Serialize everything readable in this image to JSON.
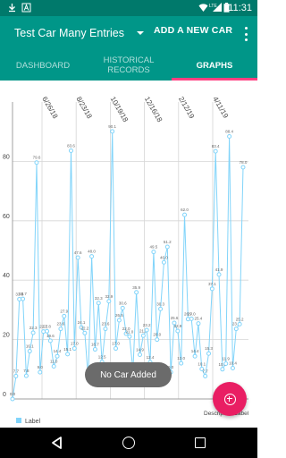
{
  "status_bar": {
    "time": "11:31",
    "left_icons": [
      "download-icon",
      "a-letter-icon"
    ],
    "right_icons": [
      "wifi-icon",
      "signal-lte-icon",
      "battery-icon"
    ],
    "lte_label": "LTE"
  },
  "app_bar": {
    "selected_car": "Test Car Many Entries",
    "add_car_label": "ADD A NEW CAR",
    "overflow_icon": "more-vert-icon"
  },
  "tabs": [
    {
      "label": "DASHBOARD",
      "active": false
    },
    {
      "label": "HISTORICAL\nRECORDS",
      "active": false
    },
    {
      "label": "GRAPHS",
      "active": true
    }
  ],
  "colors": {
    "status_bar": "#00796b",
    "primary": "#009688",
    "accent": "#ff4081",
    "fab": "#e91e63",
    "line": "#81d4fa",
    "value_text": "#666666"
  },
  "chart_data": {
    "type": "line",
    "x_tick_labels": [
      "6/26/18",
      "8/23/18",
      "10/19/18",
      "12/16/18",
      "2/12/19",
      "4/11/19"
    ],
    "y_tick_labels": [
      "0",
      "20",
      "40",
      "60",
      "80"
    ],
    "ylim": [
      0,
      100
    ],
    "legend": [
      "Label"
    ],
    "legend_position": "bottom-left",
    "description_label": "Description Label",
    "series": [
      {
        "name": "Label",
        "values": [
          0.0,
          7.7,
          33.6,
          33.7,
          7.8,
          16.1,
          22.3,
          79.6,
          9.0,
          22.7,
          22.8,
          19.6,
          11.0,
          14.4,
          23.6,
          27.9,
          15.1,
          83.6,
          17.0,
          47.6,
          24.1,
          22.2,
          7.0,
          48.0,
          16.7,
          32.3,
          12.5,
          23.6,
          32.9,
          90.1,
          17.0,
          26.5,
          30.6,
          22.0,
          21.0,
          9.7,
          35.9,
          14.9,
          21.3,
          23.2,
          12.4,
          49.5,
          20.0,
          30.3,
          46.0,
          51.2,
          9.0,
          25.6,
          22.9,
          12.0,
          62.0,
          26.9,
          27.0,
          14.4,
          25.4,
          10.1,
          7.7,
          15.3,
          37.1,
          83.4,
          41.9,
          10.0,
          11.9,
          88.4,
          10.4,
          23.6,
          25.2,
          78.0
        ]
      }
    ]
  },
  "toast": {
    "text": "No Car Added"
  },
  "fab": {
    "icon": "add-circle-icon"
  },
  "nav_bar": {
    "icons": [
      "back-icon",
      "home-icon",
      "recents-icon"
    ]
  }
}
